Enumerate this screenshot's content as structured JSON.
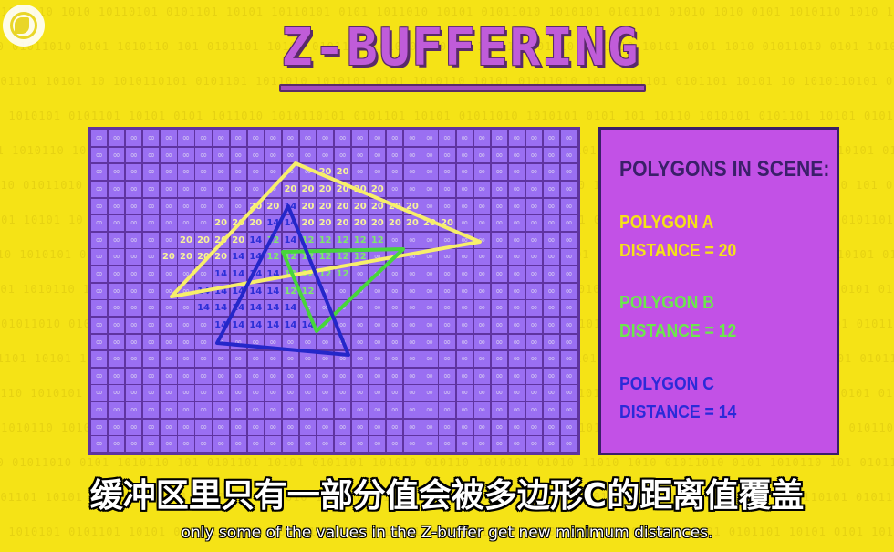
{
  "title": "Z-BUFFERING",
  "background_binary": [
    "0101 1010110 1010 10110101 0101101 10101 10110101 0101 1011010 10101 01011010 1010101 0101101 01010 1010",
    "1010 01011010 0101 1010110 101 0101101 10101 0101101 101010 010110 1010101 01010 1101010 10101 0101",
    "0101101 10101 10 1010110101 0101101 1011010 1010101 0101 1010110 10101 01011010 101 0101101",
    "10110 1010101 0101101 10101 0101 1011010 1010110101 0101101 10101 01011010 1010101 0101 101",
    "0101 1010110 1010 10110101 0101101 10101 10110101 0101 1011010 10101 01011010 1010101 0101101",
    "1010 01011010 0101 1010110 101 0101101 10101 0101101 101010 010110 1010101 01010 1101010",
    "0101101 10101 10 1010110101 0101101 1011010 1010101 0101 1010110 10101 01011010 101 0101",
    "10110 1010101 0101101 10101 0101 1011010 1010110101 0101101 10101 01011010 1010101 0101 1010",
    "0101 1010110 1010 10110101 0101101 10101 10110101 0101 1011010 10101 01011010 1010101 01011",
    "1010 01011010 0101 1010110 101 0101101 10101 0101101 101010 010110 1010101 01010 110101",
    "0101101 10101 10 1010110101 0101101 1011010 1010101 0101 1010110 10101 01011010 101 01010",
    "10110 1010101 0101101 10101 0101 1011010 1010110101 0101101 10101 01011010 1010101 0101 10",
    "0101 1010110 1010 10110101 0101101 10101 10110101 0101 1011010 10101 01011010 1010101 0101",
    "1010 01011010 0101 1010110 101 0101101 10101 0101101 101010 010110 1010101 01010 11010",
    "0101101 10101 10 1010110101 0101101 1011010 1010101 0101 1010110 10101 01011010 101 010",
    "10110 1010101 0101101 10101 0101 1011010 1010110101 0101101 10101 01011010 1010101 0101"
  ],
  "zbuffer": {
    "default_value": "∞",
    "rows": [
      [
        "∞",
        "∞",
        "∞",
        "∞",
        "∞",
        "∞",
        "∞",
        "∞",
        "∞",
        "∞",
        "∞",
        "∞",
        "∞",
        "∞",
        "∞",
        "∞",
        "∞",
        "∞",
        "∞",
        "∞",
        "∞",
        "∞",
        "∞",
        "∞",
        "∞",
        "∞",
        "∞",
        "∞"
      ],
      [
        "∞",
        "∞",
        "∞",
        "∞",
        "∞",
        "∞",
        "∞",
        "∞",
        "∞",
        "∞",
        "∞",
        "∞",
        "∞",
        "∞",
        "∞",
        "∞",
        "∞",
        "∞",
        "∞",
        "∞",
        "∞",
        "∞",
        "∞",
        "∞",
        "∞",
        "∞",
        "∞",
        "∞"
      ],
      [
        "∞",
        "∞",
        "∞",
        "∞",
        "∞",
        "∞",
        "∞",
        "∞",
        "∞",
        "∞",
        "∞",
        "∞",
        "∞",
        "20",
        "20",
        "∞",
        "∞",
        "∞",
        "∞",
        "∞",
        "∞",
        "∞",
        "∞",
        "∞",
        "∞",
        "∞",
        "∞",
        "∞"
      ],
      [
        "∞",
        "∞",
        "∞",
        "∞",
        "∞",
        "∞",
        "∞",
        "∞",
        "∞",
        "∞",
        "∞",
        "20",
        "20",
        "20",
        "20",
        "20",
        "20",
        "∞",
        "∞",
        "∞",
        "∞",
        "∞",
        "∞",
        "∞",
        "∞",
        "∞",
        "∞",
        "∞"
      ],
      [
        "∞",
        "∞",
        "∞",
        "∞",
        "∞",
        "∞",
        "∞",
        "∞",
        "∞",
        "20",
        "20",
        "14",
        "20",
        "20",
        "20",
        "20",
        "20",
        "20",
        "20",
        "∞",
        "∞",
        "∞",
        "∞",
        "∞",
        "∞",
        "∞",
        "∞",
        "∞"
      ],
      [
        "∞",
        "∞",
        "∞",
        "∞",
        "∞",
        "∞",
        "∞",
        "20",
        "20",
        "20",
        "14",
        "14",
        "20",
        "20",
        "20",
        "20",
        "20",
        "20",
        "20",
        "20",
        "20",
        "∞",
        "∞",
        "∞",
        "∞",
        "∞",
        "∞",
        "∞"
      ],
      [
        "∞",
        "∞",
        "∞",
        "∞",
        "∞",
        "20",
        "20",
        "20",
        "20",
        "14",
        "12",
        "14",
        "12",
        "12",
        "12",
        "12",
        "12",
        "∞",
        "∞",
        "∞",
        "∞",
        "∞",
        "∞",
        "∞",
        "∞",
        "∞",
        "∞",
        "∞"
      ],
      [
        "∞",
        "∞",
        "∞",
        "∞",
        "20",
        "20",
        "20",
        "20",
        "14",
        "14",
        "12",
        "12",
        "12",
        "12",
        "12",
        "12",
        "∞",
        "∞",
        "∞",
        "∞",
        "∞",
        "∞",
        "∞",
        "∞",
        "∞",
        "∞",
        "∞",
        "∞"
      ],
      [
        "∞",
        "∞",
        "∞",
        "∞",
        "∞",
        "∞",
        "∞",
        "14",
        "14",
        "14",
        "14",
        "12",
        "12",
        "12",
        "12",
        "∞",
        "∞",
        "∞",
        "∞",
        "∞",
        "∞",
        "∞",
        "∞",
        "∞",
        "∞",
        "∞",
        "∞",
        "∞"
      ],
      [
        "∞",
        "∞",
        "∞",
        "∞",
        "∞",
        "∞",
        "14",
        "14",
        "14",
        "14",
        "14",
        "12",
        "12",
        "∞",
        "∞",
        "∞",
        "∞",
        "∞",
        "∞",
        "∞",
        "∞",
        "∞",
        "∞",
        "∞",
        "∞",
        "∞",
        "∞",
        "∞"
      ],
      [
        "∞",
        "∞",
        "∞",
        "∞",
        "∞",
        "∞",
        "14",
        "14",
        "14",
        "14",
        "14",
        "14",
        "∞",
        "∞",
        "∞",
        "∞",
        "∞",
        "∞",
        "∞",
        "∞",
        "∞",
        "∞",
        "∞",
        "∞",
        "∞",
        "∞",
        "∞",
        "∞"
      ],
      [
        "∞",
        "∞",
        "∞",
        "∞",
        "∞",
        "∞",
        "∞",
        "14",
        "14",
        "14",
        "14",
        "14",
        "14",
        "∞",
        "∞",
        "∞",
        "∞",
        "∞",
        "∞",
        "∞",
        "∞",
        "∞",
        "∞",
        "∞",
        "∞",
        "∞",
        "∞",
        "∞"
      ],
      [
        "∞",
        "∞",
        "∞",
        "∞",
        "∞",
        "∞",
        "∞",
        "∞",
        "∞",
        "∞",
        "∞",
        "∞",
        "∞",
        "∞",
        "∞",
        "∞",
        "∞",
        "∞",
        "∞",
        "∞",
        "∞",
        "∞",
        "∞",
        "∞",
        "∞",
        "∞",
        "∞",
        "∞"
      ],
      [
        "∞",
        "∞",
        "∞",
        "∞",
        "∞",
        "∞",
        "∞",
        "∞",
        "∞",
        "∞",
        "∞",
        "∞",
        "∞",
        "∞",
        "∞",
        "∞",
        "∞",
        "∞",
        "∞",
        "∞",
        "∞",
        "∞",
        "∞",
        "∞",
        "∞",
        "∞",
        "∞",
        "∞"
      ],
      [
        "∞",
        "∞",
        "∞",
        "∞",
        "∞",
        "∞",
        "∞",
        "∞",
        "∞",
        "∞",
        "∞",
        "∞",
        "∞",
        "∞",
        "∞",
        "∞",
        "∞",
        "∞",
        "∞",
        "∞",
        "∞",
        "∞",
        "∞",
        "∞",
        "∞",
        "∞",
        "∞",
        "∞"
      ],
      [
        "∞",
        "∞",
        "∞",
        "∞",
        "∞",
        "∞",
        "∞",
        "∞",
        "∞",
        "∞",
        "∞",
        "∞",
        "∞",
        "∞",
        "∞",
        "∞",
        "∞",
        "∞",
        "∞",
        "∞",
        "∞",
        "∞",
        "∞",
        "∞",
        "∞",
        "∞",
        "∞",
        "∞"
      ],
      [
        "∞",
        "∞",
        "∞",
        "∞",
        "∞",
        "∞",
        "∞",
        "∞",
        "∞",
        "∞",
        "∞",
        "∞",
        "∞",
        "∞",
        "∞",
        "∞",
        "∞",
        "∞",
        "∞",
        "∞",
        "∞",
        "∞",
        "∞",
        "∞",
        "∞",
        "∞",
        "∞",
        "∞"
      ],
      [
        "∞",
        "∞",
        "∞",
        "∞",
        "∞",
        "∞",
        "∞",
        "∞",
        "∞",
        "∞",
        "∞",
        "∞",
        "∞",
        "∞",
        "∞",
        "∞",
        "∞",
        "∞",
        "∞",
        "∞",
        "∞",
        "∞",
        "∞",
        "∞",
        "∞",
        "∞",
        "∞",
        "∞"
      ],
      [
        "∞",
        "∞",
        "∞",
        "∞",
        "∞",
        "∞",
        "∞",
        "∞",
        "∞",
        "∞",
        "∞",
        "∞",
        "∞",
        "∞",
        "∞",
        "∞",
        "∞",
        "∞",
        "∞",
        "∞",
        "∞",
        "∞",
        "∞",
        "∞",
        "∞",
        "∞",
        "∞",
        "∞"
      ]
    ]
  },
  "polygons": [
    {
      "key": "a",
      "color": "#f7ef6a"
    },
    {
      "key": "b",
      "color": "#47d63a"
    },
    {
      "key": "c",
      "color": "#2427c9"
    }
  ],
  "panel": {
    "heading": "POLYGONS IN SCENE:",
    "polygon_a": {
      "name": "POLYGON A",
      "distance": "DISTANCE = 20",
      "color": "#f5e316"
    },
    "polygon_b": {
      "name": "POLYGON B",
      "distance": "DISTANCE = 12",
      "color": "#6be84c"
    },
    "polygon_c": {
      "name": "POLYGON C",
      "distance": "DISTANCE = 14",
      "color": "#2b2ad8"
    }
  },
  "subtitles": {
    "chinese": "缓冲区里只有一部分值会被多边形C的距离值覆盖",
    "english": "only some of the values in the Z-buffer get new minimum distances."
  }
}
